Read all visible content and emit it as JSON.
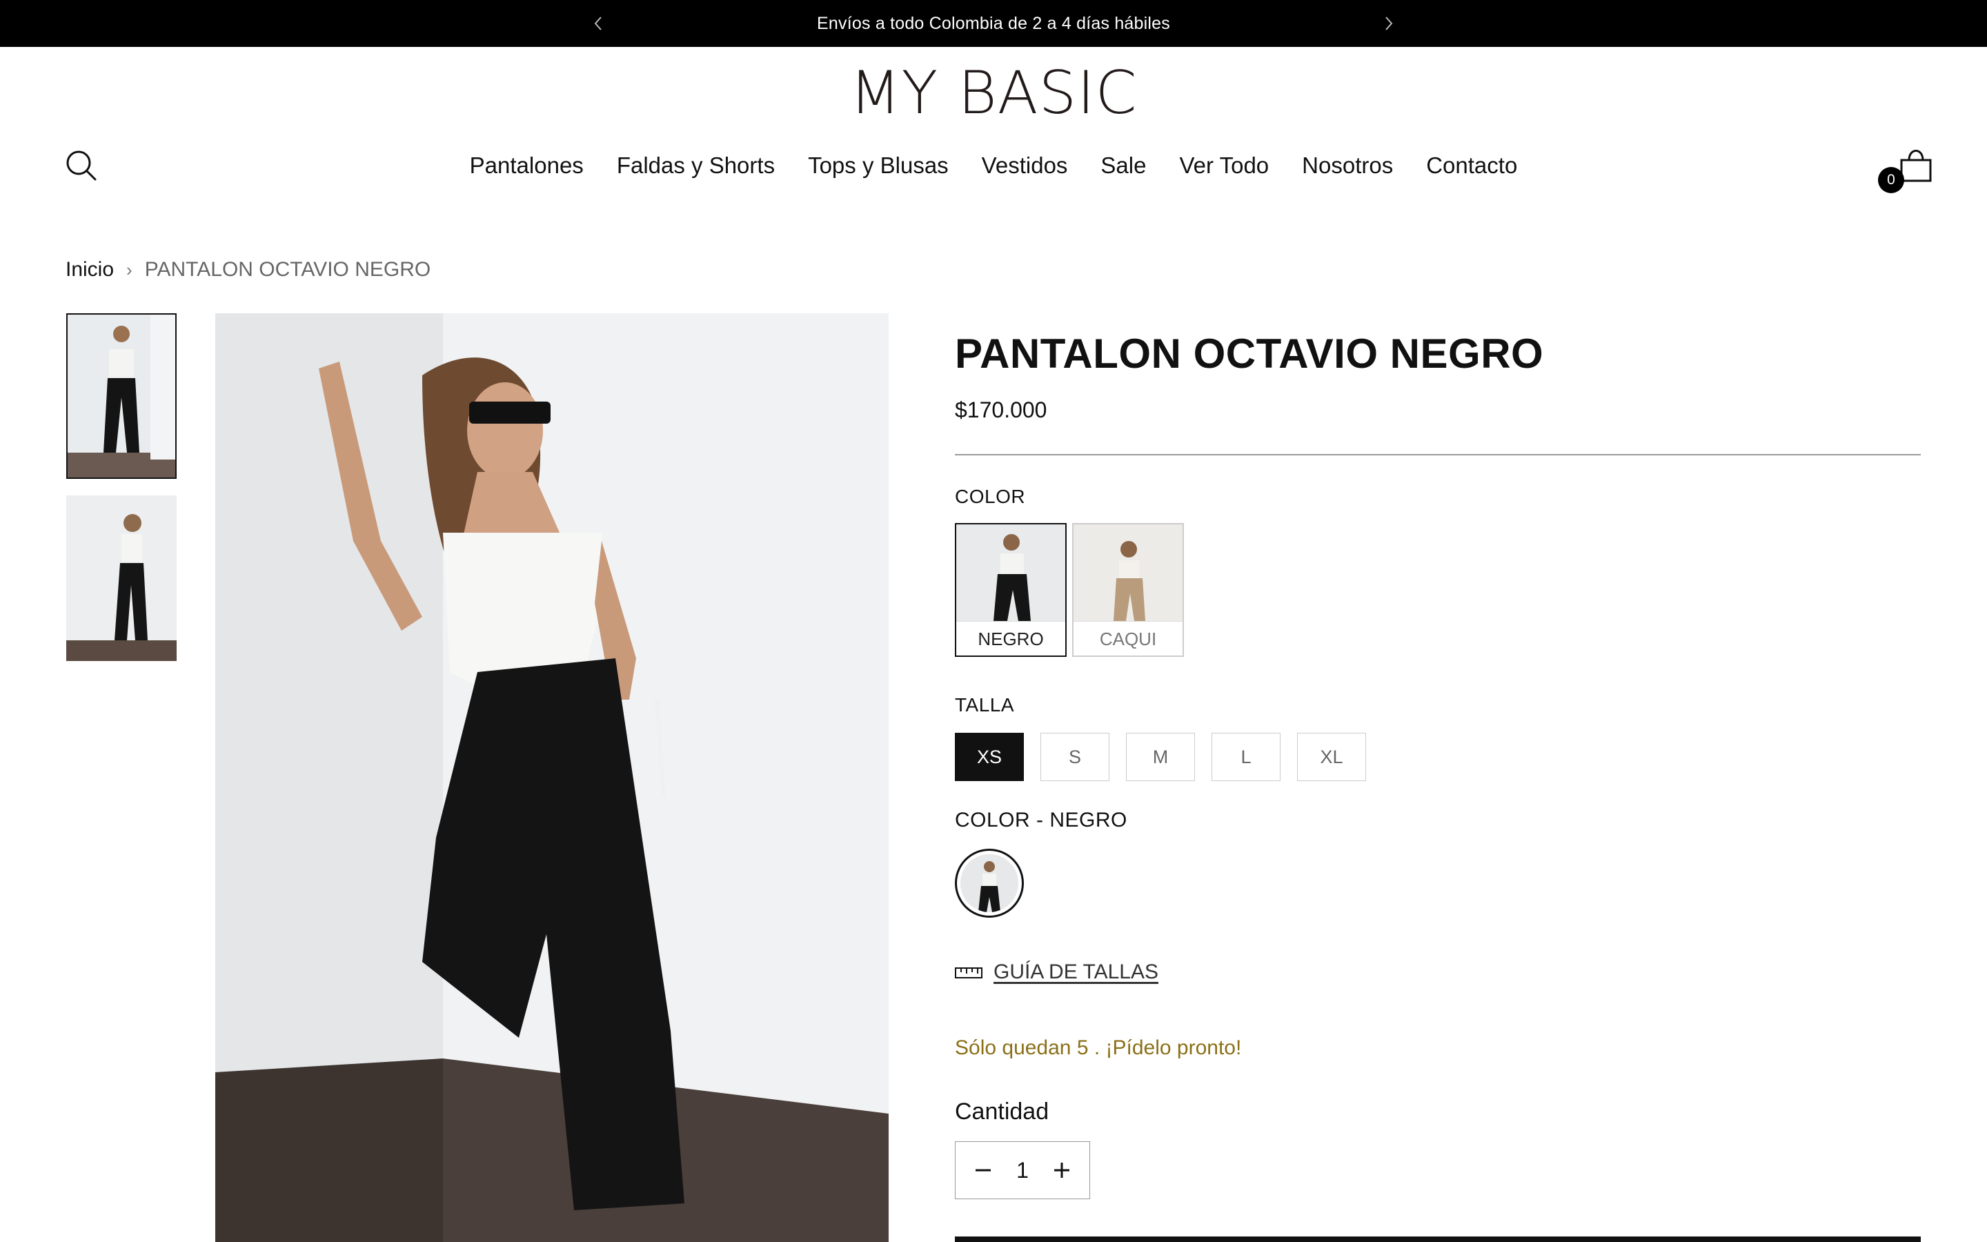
{
  "announcement": {
    "text": "Envíos a todo Colombia de 2 a 4 días hábiles"
  },
  "header": {
    "logo": "MY BASIC",
    "cart_count": "0",
    "nav": [
      "Pantalones",
      "Faldas y Shorts",
      "Tops y Blusas",
      "Vestidos",
      "Sale",
      "Ver Todo",
      "Nosotros",
      "Contacto"
    ]
  },
  "breadcrumb": {
    "home": "Inicio",
    "separator": "›",
    "current": "PANTALON OCTAVIO NEGRO"
  },
  "product": {
    "title": "PANTALON OCTAVIO NEGRO",
    "price": "$170.000",
    "color_label": "COLOR",
    "colors": [
      {
        "name": "NEGRO",
        "selected": true
      },
      {
        "name": "CAQUI",
        "selected": false
      }
    ],
    "size_label": "TALLA",
    "sizes": [
      {
        "label": "XS",
        "selected": true
      },
      {
        "label": "S",
        "selected": false
      },
      {
        "label": "M",
        "selected": false
      },
      {
        "label": "L",
        "selected": false
      },
      {
        "label": "XL",
        "selected": false
      }
    ],
    "color_variant_label": "COLOR - NEGRO",
    "size_guide": "GUÍA DE TALLAS",
    "stock_message": "Sólo quedan 5 . ¡Pídelo pronto!",
    "quantity_label": "Cantidad",
    "quantity": "1"
  },
  "colors": {
    "announcement_bg": "#000000",
    "stock_text": "#8a7018",
    "accent": "#111111"
  },
  "icons": [
    "chevron-left-icon",
    "chevron-right-icon",
    "search-icon",
    "shopping-bag-icon",
    "ruler-icon",
    "minus-icon",
    "plus-icon"
  ]
}
